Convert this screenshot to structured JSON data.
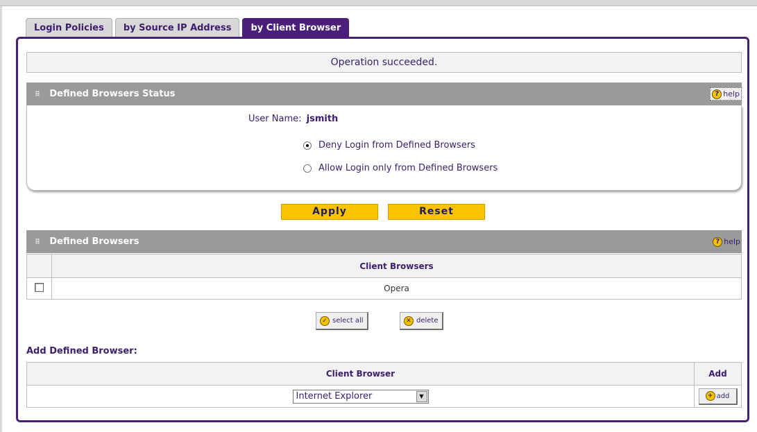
{
  "tabs": [
    {
      "label": "Login Policies",
      "active": false
    },
    {
      "label": "by Source IP Address",
      "active": false
    },
    {
      "label": "by Client Browser",
      "active": true
    }
  ],
  "message": "Operation succeeded.",
  "status_section": {
    "title": "Defined Browsers Status",
    "help_label": "help",
    "username_label": "User Name:",
    "username_value": "jsmith",
    "options": [
      {
        "label": "Deny Login from Defined Browsers",
        "checked": true
      },
      {
        "label": "Allow Login only from Defined Browsers",
        "checked": false
      }
    ]
  },
  "buttons": {
    "apply": "Apply",
    "reset": "Reset",
    "select_all": "select all",
    "delete": "delete",
    "add": "add"
  },
  "browsers_section": {
    "title": "Defined Browsers",
    "help_label": "help",
    "column_header": "Client Browsers",
    "rows": [
      {
        "name": "Opera",
        "checked": false
      }
    ]
  },
  "add_section": {
    "title": "Add Defined Browser:",
    "col_browser": "Client Browser",
    "col_add": "Add",
    "selected_browser": "Internet Explorer"
  },
  "colors": {
    "accent": "#4a1f7a",
    "button_yellow": "#f9c300",
    "section_gray": "#9a9a9a"
  }
}
